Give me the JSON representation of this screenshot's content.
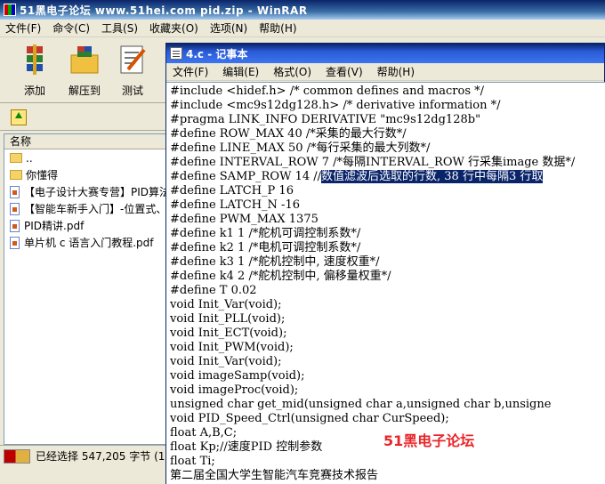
{
  "winrar": {
    "title": "51黑电子论坛 www.51hei.com pid.zip - WinRAR",
    "menu": [
      "文件(F)",
      "命令(C)",
      "工具(S)",
      "收藏夹(O)",
      "选项(N)",
      "帮助(H)"
    ],
    "toolbar": [
      {
        "label": "添加",
        "icon": "add-archive-icon"
      },
      {
        "label": "解压到",
        "icon": "extract-to-icon"
      },
      {
        "label": "测试",
        "icon": "test-icon"
      }
    ],
    "column_header": "名称",
    "files": [
      {
        "name": "..",
        "type": "folder"
      },
      {
        "name": "你懂得",
        "type": "folder"
      },
      {
        "name": "【电子设计大赛专营】PID算法",
        "type": "file"
      },
      {
        "name": "【智能车新手入门】-位置式、",
        "type": "file"
      },
      {
        "name": "PID精讲.pdf",
        "type": "file"
      },
      {
        "name": "单片机 c 语言入门教程.pdf",
        "type": "file"
      }
    ],
    "status": "已经选择 547,205 字节 (1"
  },
  "notepad": {
    "title": "4.c - 记事本",
    "menu": [
      "文件(F)",
      "编辑(E)",
      "格式(O)",
      "查看(V)",
      "帮助(H)"
    ],
    "lines": [
      "#include <hidef.h> /* common defines and macros */",
      "#include <mc9s12dg128.h> /* derivative information */",
      "#pragma LINK_INFO DERIVATIVE \"mc9s12dg128b\"",
      "#define ROW_MAX 40 /*采集的最大行数*/",
      "#define LINE_MAX 50 /*每行采集的最大列数*/",
      "#define INTERVAL_ROW 7 /*每隔INTERVAL_ROW 行采集image 数据*/",
      "#define SAMP_ROW 14 //",
      "#define LATCH_P 16",
      "#define LATCH_N -16",
      "#define PWM_MAX 1375",
      "#define k1 1 /*舵机可调控制系数*/",
      "#define k2 1 /*电机可调控制系数*/",
      "#define k3 1 /*舵机控制中, 速度权重*/",
      "#define k4 2 /*舵机控制中, 偏移量权重*/",
      "#define T 0.02",
      "void Init_Var(void);",
      "void Init_PLL(void);",
      "void Init_ECT(void);",
      "void Init_PWM(void);",
      "void Init_Var(void);",
      "void imageSamp(void);",
      "void imageProc(void);",
      "unsigned char get_mid(unsigned char a,unsigned char b,unsigne",
      "void PID_Speed_Ctrl(unsigned char CurSpeed);",
      "float A,B,C;",
      "float Kp;//速度PID 控制参数",
      "float Ti;",
      "第二届全国大学生智能汽车竞赛技术报告"
    ],
    "selected_text": "数值滤波后选取的行数, 38 行中每隔3 行取"
  },
  "watermark": "51黑电子论坛"
}
